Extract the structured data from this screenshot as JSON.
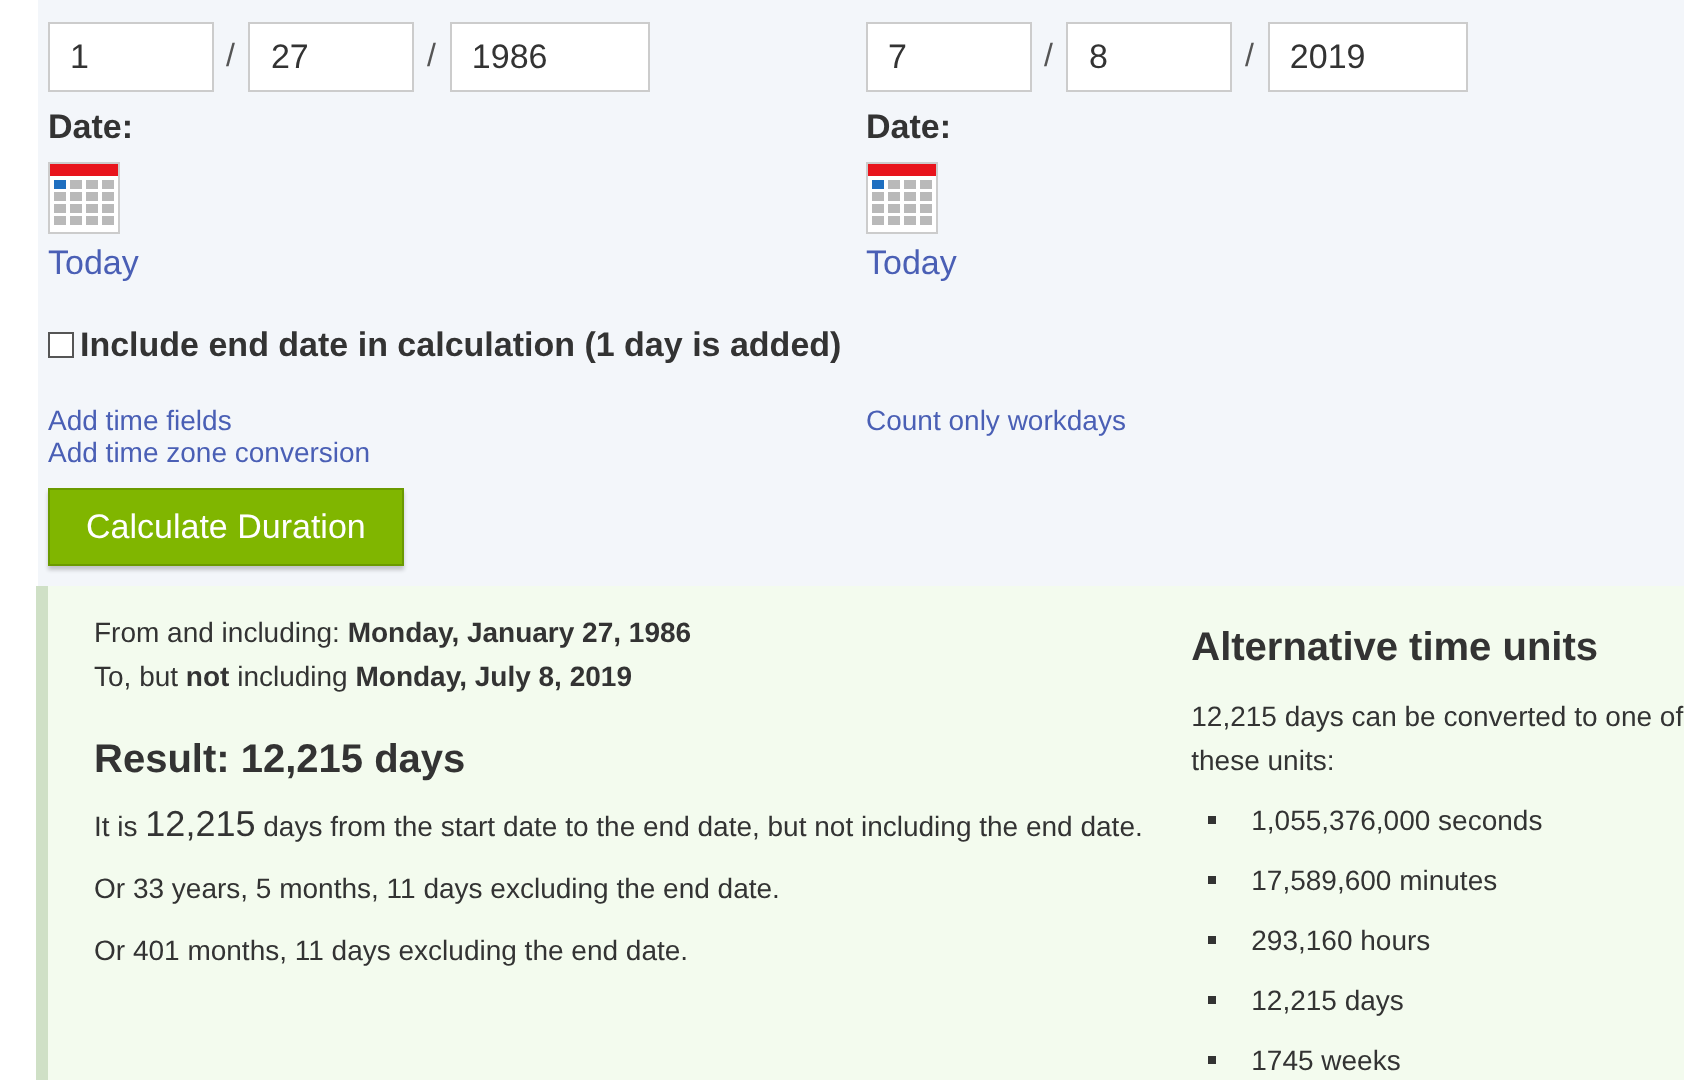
{
  "start": {
    "month": "1",
    "day": "27",
    "year": "1986",
    "separators": [
      "/",
      "/"
    ],
    "date_label": "Date:",
    "today_link": "Today"
  },
  "end": {
    "month": "7",
    "day": "8",
    "year": "2019",
    "separators": [
      "/",
      "/"
    ],
    "date_label": "Date:",
    "today_link": "Today"
  },
  "include_end_date": {
    "label": "Include end date in calculation (1 day is added)",
    "checked": false
  },
  "left_links": [
    "Add time fields",
    "Add time zone conversion"
  ],
  "right_links": [
    "Count only workdays"
  ],
  "calculate_button": "Calculate Duration",
  "result": {
    "from_line": "From and including: **Monday, January 27, 1986**",
    "to_line": "To, but **not** including **Monday, July 8, 2019**",
    "heading": "Result: 12,215 days",
    "summary": {
      "prefix": "It is ",
      "number": "12,215",
      "suffix": " days from the start date to the end date, but not including the end date."
    },
    "alternatives": [
      "Or 33 years, 5 months, 11 days excluding the end date.",
      "Or 401 months, 11 days excluding the end date."
    ]
  },
  "alternative_units": {
    "heading": "Alternative time units",
    "intro": "12,215 days can be converted to one of these units:",
    "units": [
      "1,055,376,000 seconds",
      "17,589,600 minutes",
      "293,160 hours",
      "12,215 days",
      "1745 weeks"
    ]
  }
}
